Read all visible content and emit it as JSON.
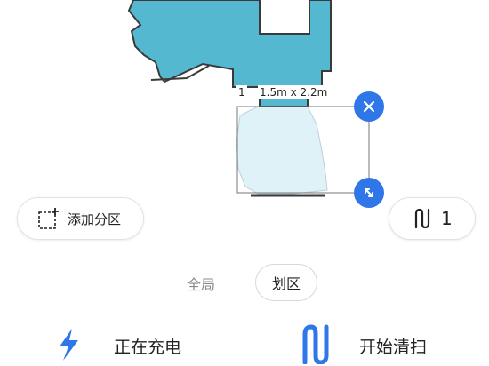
{
  "map": {
    "zone_dimensions": "1.5m x 2.2m",
    "zone_index": "1"
  },
  "buttons": {
    "add_zone": "添加分区",
    "zone_count": "1"
  },
  "mode": {
    "all": "全局",
    "zone": "划区"
  },
  "actions": {
    "charging": "正在充电",
    "start_clean": "开始清扫"
  },
  "colors": {
    "map_fill": "#53b8d0",
    "zone_fill": "#dff2f8",
    "accent": "#2f76e8"
  },
  "icons": {
    "close": "close-icon",
    "resize": "resize-icon",
    "add_zone": "add-zone-icon",
    "path": "path-icon",
    "lightning": "lightning-icon"
  }
}
